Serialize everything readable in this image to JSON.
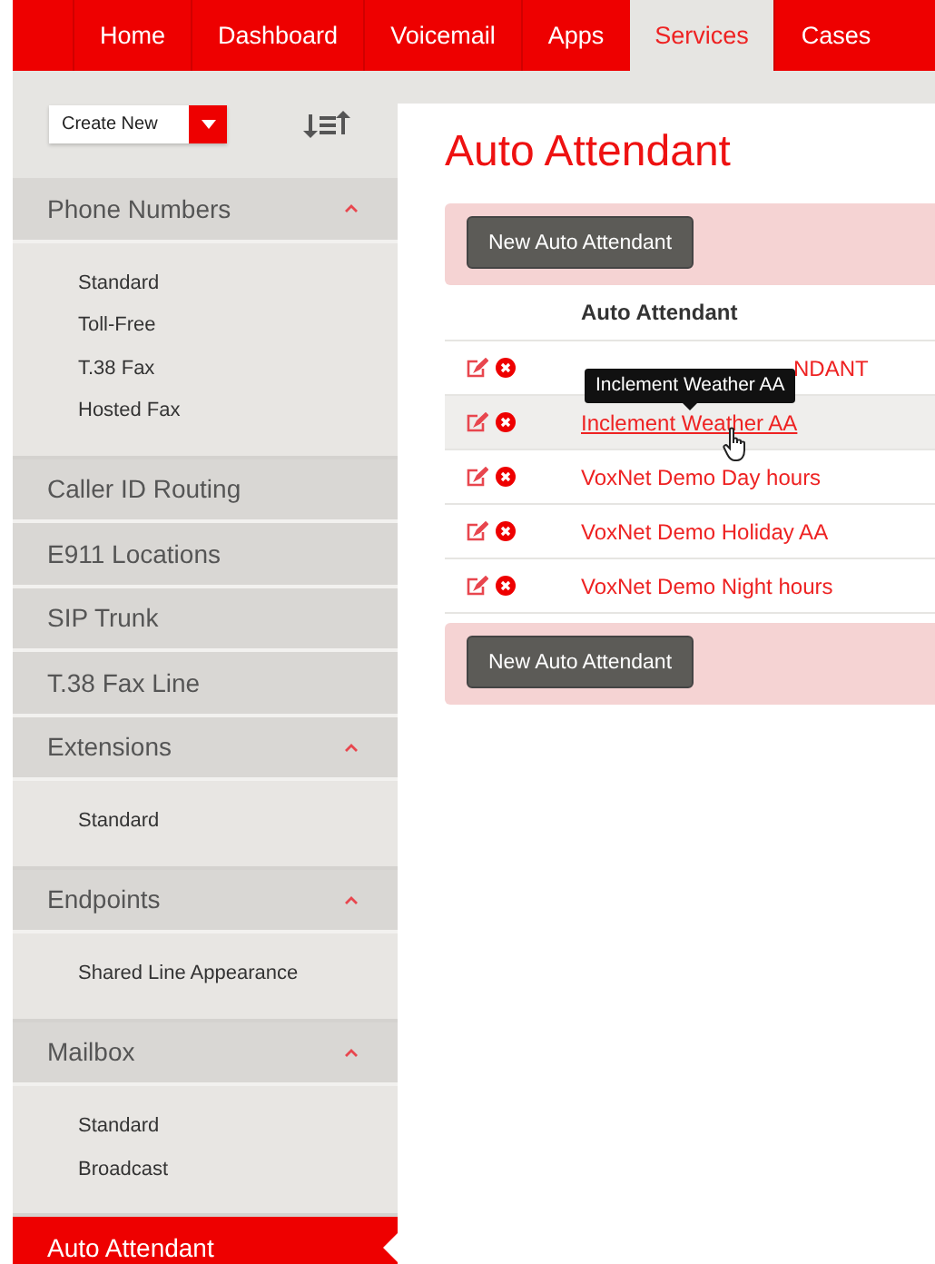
{
  "nav": {
    "tabs": [
      {
        "label": "Home",
        "selected": false
      },
      {
        "label": "Dashboard",
        "selected": false
      },
      {
        "label": "Voicemail",
        "selected": false
      },
      {
        "label": "Apps",
        "selected": false
      },
      {
        "label": "Services",
        "selected": true
      },
      {
        "label": "Cases",
        "selected": false
      }
    ]
  },
  "toolbar": {
    "create_new": "Create New"
  },
  "sidebar": {
    "items": [
      {
        "label": "Phone Numbers",
        "selected": false,
        "expanded": true,
        "children": [
          {
            "label": "Standard"
          },
          {
            "label": "Toll-Free"
          },
          {
            "label": "T.38 Fax"
          },
          {
            "label": "Hosted Fax"
          }
        ]
      },
      {
        "label": "Caller ID Routing",
        "selected": false
      },
      {
        "label": "E911 Locations",
        "selected": false
      },
      {
        "label": "SIP Trunk",
        "selected": false
      },
      {
        "label": "T.38 Fax Line",
        "selected": false
      },
      {
        "label": "Extensions",
        "selected": false,
        "expanded": true,
        "children": [
          {
            "label": "Standard"
          }
        ]
      },
      {
        "label": "Endpoints",
        "selected": false,
        "expanded": true,
        "children": [
          {
            "label": "Shared Line Appearance"
          }
        ]
      },
      {
        "label": "Mailbox",
        "selected": false,
        "expanded": true,
        "children": [
          {
            "label": "Standard"
          },
          {
            "label": "Broadcast"
          }
        ]
      },
      {
        "label": "Auto Attendant",
        "selected": true
      }
    ]
  },
  "main": {
    "title": "Auto Attendant",
    "new_button": "New Auto Attendant",
    "bottom_button": "New Auto Attendant",
    "table": {
      "columns": [
        {
          "label": "Auto Attendant"
        }
      ],
      "rows": [
        {
          "name": "NDANT",
          "hovered": false,
          "covered": true
        },
        {
          "name": "Inclement Weather AA",
          "hovered": true,
          "covered": false
        },
        {
          "name": "VoxNet Demo Day hours",
          "hovered": false,
          "covered": false
        },
        {
          "name": "VoxNet Demo Holiday AA",
          "hovered": false,
          "covered": false
        },
        {
          "name": "VoxNet Demo Night hours",
          "hovered": false,
          "covered": false
        }
      ]
    },
    "tooltip": {
      "text": "Inclement Weather AA"
    }
  }
}
